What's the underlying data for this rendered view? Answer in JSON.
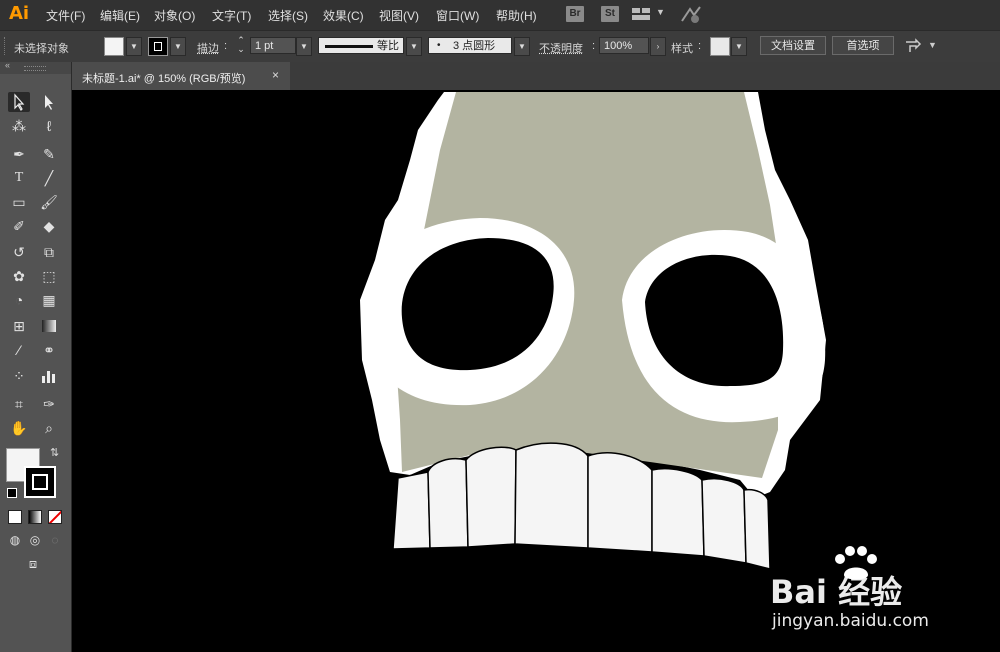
{
  "app": {
    "logo": "Ai"
  },
  "menu": [
    "文件(F)",
    "编辑(E)",
    "对象(O)",
    "文字(T)",
    "选择(S)",
    "效果(C)",
    "视图(V)",
    "窗口(W)",
    "帮助(H)"
  ],
  "menu_icons": {
    "br": "Br",
    "st": "St"
  },
  "control_bar": {
    "selection": "未选择对象",
    "stroke_label": "描边",
    "stroke_weight": "1 pt",
    "stroke_profile": "等比",
    "brush": "3 点圆形",
    "opacity_label": "不透明度",
    "opacity": "100%",
    "style_label": "样式",
    "doc_setup": "文档设置",
    "preferences": "首选项"
  },
  "document_tab": {
    "title": "未标题-1.ai* @ 150% (RGB/预览)",
    "close": "×"
  },
  "canvas": {
    "background": "#000000",
    "skull_fill": "#b3b4a1",
    "outline_fill": "#ffffff",
    "teeth_fill": "#f5f5f5"
  },
  "tool_icons": [
    "selection-tool",
    "direct-selection-tool",
    "magic-wand-tool",
    "lasso-tool",
    "pen-tool",
    "curvature-tool",
    "type-tool",
    "line-tool",
    "rectangle-tool",
    "paintbrush-tool",
    "shaper-tool",
    "eraser-tool",
    "rotate-tool",
    "scale-tool",
    "warp-tool",
    "free-transform-tool",
    "shape-builder-tool",
    "perspective-grid-tool",
    "mesh-tool",
    "gradient-tool",
    "eyedropper-tool",
    "blend-tool",
    "symbol-sprayer-tool",
    "graph-tool",
    "artboard-tool",
    "slice-tool",
    "hand-tool",
    "zoom-tool"
  ],
  "watermark": {
    "brand": "Bai 经验",
    "url": "jingyan.baidu.com"
  }
}
